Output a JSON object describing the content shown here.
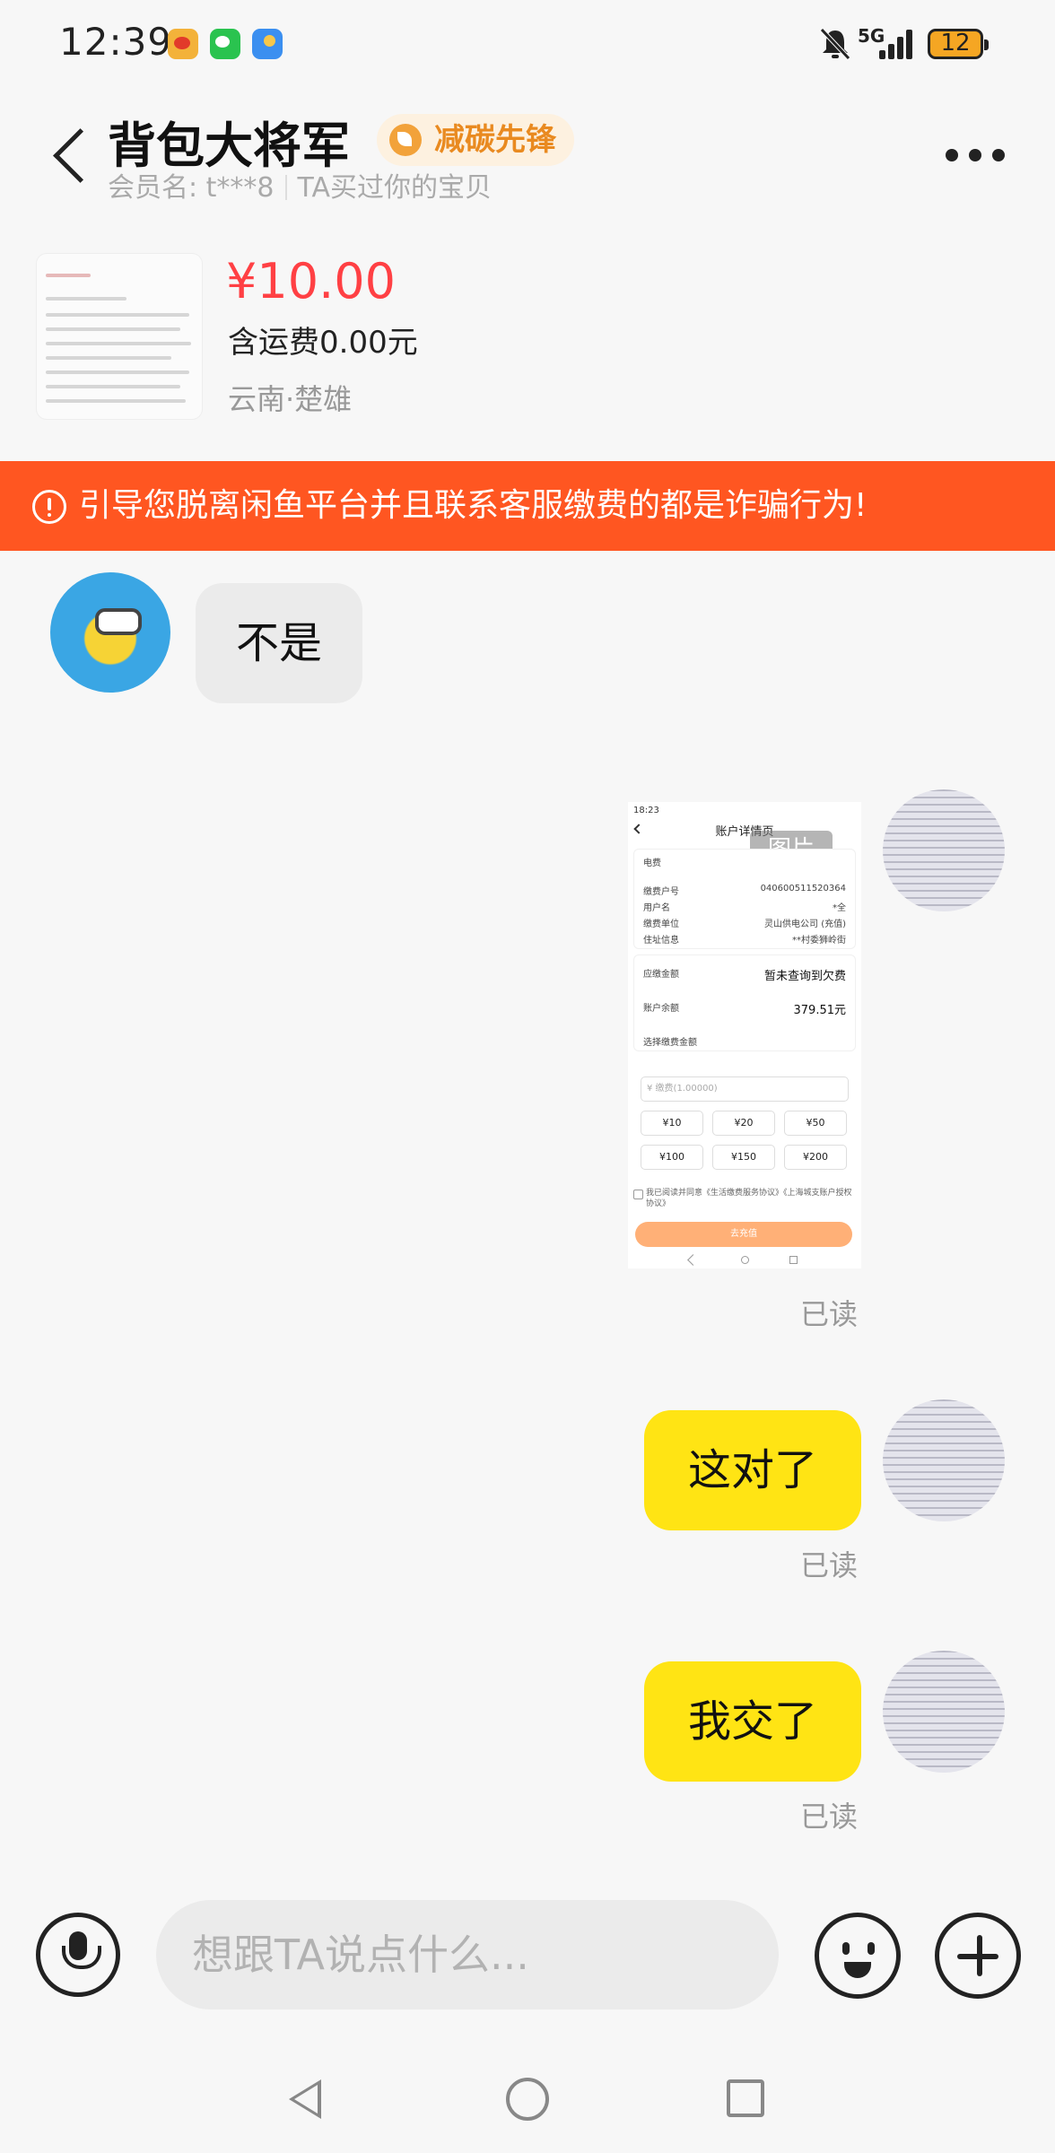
{
  "status_bar": {
    "time": "12:39",
    "network": "5G",
    "battery": "12",
    "app_icons": [
      "weibo-icon",
      "wechat-icon",
      "weather-icon"
    ]
  },
  "header": {
    "contact_name": "背包大将军",
    "badge": "减碳先锋",
    "member_label": "会员名: t***8",
    "relation": "TA买过你的宝贝"
  },
  "product": {
    "price": "¥10.00",
    "shipping": "含运费0.00元",
    "location": "云南·楚雄"
  },
  "warning": {
    "text": "引导您脱离闲鱼平台并且联系客服缴费的都是诈骗行为!",
    "color": "#ff5621"
  },
  "messages": [
    {
      "side": "left",
      "type": "text",
      "text": "不是"
    },
    {
      "side": "right",
      "type": "image",
      "read": "已读"
    },
    {
      "side": "right",
      "type": "text",
      "text": "这对了",
      "read": "已读"
    },
    {
      "side": "right",
      "type": "text",
      "text": "我交了",
      "read": "已读"
    }
  ],
  "image_message": {
    "tag": "图片",
    "time": "18:23",
    "title": "账户详情页",
    "service": "电费",
    "rows": [
      {
        "label": "缴费户号",
        "value": "0406005115203​64"
      },
      {
        "label": "用户名",
        "value": "*全"
      },
      {
        "label": "缴费单位",
        "value": "灵山供电公司 (充值)"
      },
      {
        "label": "住址信息",
        "value": "**村委狮岭街"
      }
    ],
    "due_label": "应缴金额",
    "due_value": "暂未查询到欠费",
    "balance_label": "账户余额",
    "balance_value": "379.51元",
    "choose_label": "选择缴费金额",
    "amount_placeholder": "¥ 缴费(1.00000)",
    "options": [
      "¥10",
      "¥20",
      "¥50",
      "¥100",
      "¥150",
      "¥200"
    ],
    "agreement": "我已阅读并同意《生活缴费服务协议》《上海城支账户授权协议》",
    "submit": "去充值"
  },
  "input_bar": {
    "placeholder": "想跟TA说点什么..."
  },
  "colors": {
    "price": "#ff4044",
    "my_bubble": "#ffe414",
    "their_bubble": "#ebebeb",
    "badge_text": "#e98a20"
  }
}
